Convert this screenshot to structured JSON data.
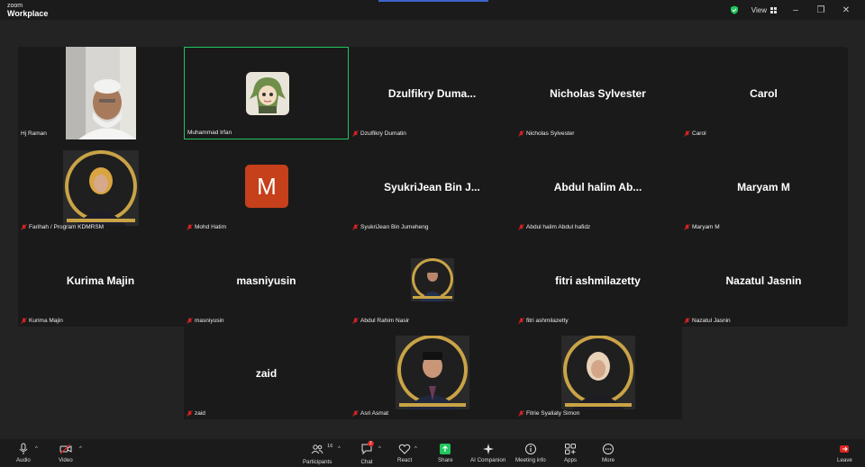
{
  "app": {
    "brand_small": "zoom",
    "brand_big": "Workplace"
  },
  "titlebar": {
    "view_label": "View"
  },
  "tiles": [
    {
      "name": "Hj Raman",
      "display": "",
      "kind": "photo-man"
    },
    {
      "name": "Muhammad Irfan",
      "display": "",
      "kind": "avatar-anime",
      "active": true
    },
    {
      "name": "Dzulfikry Dumatin",
      "display": "Dzulfikry  Duma..."
    },
    {
      "name": "Nicholas Sylvester",
      "display": "Nicholas Sylvester"
    },
    {
      "name": "Carol",
      "display": "Carol"
    },
    {
      "name": "Farihah / Program KDMRSM",
      "display": "",
      "kind": "photo-woman"
    },
    {
      "name": "Mohd Hatim",
      "display": "",
      "kind": "letter",
      "letter": "M"
    },
    {
      "name": "SyukriJean Bin Jumeheng",
      "display": "SyukriJean  Bin  J..."
    },
    {
      "name": "Abdul halim Abdul hafidz",
      "display": "Abdul  halim  Ab..."
    },
    {
      "name": "Maryam M",
      "display": "Maryam M"
    },
    {
      "name": "Kurima Majin",
      "display": "Kurima Majin"
    },
    {
      "name": "masniyusin",
      "display": "masniyusin"
    },
    {
      "name": "Abdul Rahim Nasir",
      "display": "",
      "kind": "photo-man2"
    },
    {
      "name": "fitri ashmilazetty",
      "display": "fitri ashmilazetty"
    },
    {
      "name": "Nazatul Jasnin",
      "display": "Nazatul Jasnin"
    }
  ],
  "bottom_tiles": [
    {
      "name": "zaid",
      "display": "zaid"
    },
    {
      "name": "Asri Asmat",
      "display": "",
      "kind": "photo-man3"
    },
    {
      "name": "Fitrie Syaliaty Simon",
      "display": "",
      "kind": "photo-woman2"
    }
  ],
  "toolbar": {
    "audio": "Audio",
    "video": "Video",
    "participants": "Participants",
    "participants_count": "16",
    "chat": "Chat",
    "chat_badge": "2",
    "react": "React",
    "share": "Share",
    "ai": "AI Companion",
    "meeting_info": "Meeting info",
    "apps": "Apps",
    "more": "More",
    "leave": "Leave"
  },
  "colors": {
    "active_border": "#22c55e",
    "letter_tile": "#c5401b",
    "share": "#22c55e",
    "muted": "#e02424",
    "gold_ring": "#c9a346"
  }
}
